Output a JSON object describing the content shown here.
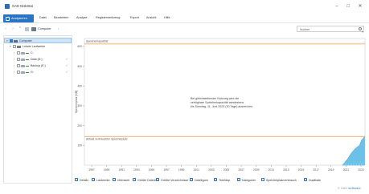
{
  "window": {
    "title": "GAD DiskStat"
  },
  "menu": {
    "active": "Analysieren",
    "items": [
      "Datei",
      "Bearbeiten",
      "Analyse",
      "Registerwerkzeug",
      "Export",
      "Ansicht",
      "Hilfe"
    ]
  },
  "nav": {
    "breadcrumb": "Computer",
    "search_value": "Suchen"
  },
  "tree": [
    {
      "label": "Computer",
      "level": 0,
      "expanded": true,
      "checked": true,
      "selected": true,
      "icon": "computer-icon"
    },
    {
      "label": "Lokale Laufwerke",
      "level": 1,
      "expanded": true,
      "checked": false,
      "selected": false,
      "icon": "drives-icon"
    },
    {
      "label": "C:",
      "level": 2,
      "expanded": false,
      "checked": false,
      "selected": false,
      "icon": "drive-icon",
      "ok": false
    },
    {
      "label": "Data (D:)",
      "level": 2,
      "expanded": false,
      "checked": false,
      "selected": false,
      "icon": "drive-icon",
      "ok": true
    },
    {
      "label": "Backup (E:)",
      "level": 2,
      "expanded": false,
      "checked": false,
      "selected": false,
      "icon": "drive-icon",
      "ok": true
    },
    {
      "label": "G:",
      "level": 2,
      "expanded": false,
      "checked": false,
      "selected": false,
      "icon": "drive-icon",
      "ok": true
    }
  ],
  "chart_data": {
    "type": "area",
    "ylabel": "Speicherplatz [GB]",
    "ylim": [
      0,
      600
    ],
    "y_ticks": [
      "100",
      "200",
      "300",
      "400",
      "500",
      "600"
    ],
    "x_ticks": [
      "1997",
      "1999",
      "1991",
      "1993",
      "1995",
      "1997",
      "1999",
      "2001",
      "2003",
      "2005",
      "2007",
      "2009",
      "2011",
      "2013",
      "2015",
      "2017",
      "2019",
      "2021",
      "2023"
    ],
    "capacity_line": {
      "label": "Speicherkapazität",
      "value": 615,
      "color": "#e8a04a"
    },
    "used_line": {
      "label": "Aktuell verbrauchter Speicherplatz",
      "value": 144,
      "color": "#e8a04a"
    },
    "annotation": [
      "Bei gleichbleibender Nutzung wird die",
      "verfügbare Speicherkapazität mindestens",
      "bis Sonntag, 11. Juni 2023 (30 Tage) ausreichen."
    ],
    "series": [
      {
        "x": [
          2021.1,
          2021.6,
          2022.0,
          2022.4,
          2022.8,
          2023.0,
          2023.3
        ],
        "y": [
          0,
          30,
          62,
          85,
          100,
          125,
          144
        ],
        "color": "#6cc1e8"
      }
    ],
    "grid": false
  },
  "bottom_tabs": [
    {
      "label": "Details",
      "icon": "details-icon"
    },
    {
      "label": "Laufwerke",
      "icon": "drives-icon"
    },
    {
      "label": "Übersicht",
      "icon": "overview-icon"
    },
    {
      "label": "Größte Dateien",
      "icon": "largest-files-icon"
    },
    {
      "label": "Größte Verzeichnisse",
      "icon": "largest-folders-icon"
    },
    {
      "label": "Dateitypen",
      "icon": "filetypes-icon"
    },
    {
      "label": "TreeMap",
      "icon": "treemap-icon"
    },
    {
      "label": "Kategorien",
      "icon": "categories-icon"
    },
    {
      "label": "Speicherplatzverbrauch",
      "icon": "usage-icon"
    },
    {
      "label": "Duplikate",
      "icon": "duplicates-icon"
    }
  ],
  "footer": {
    "brand_prefix": "© GAD",
    "brand_suffix": "software"
  }
}
